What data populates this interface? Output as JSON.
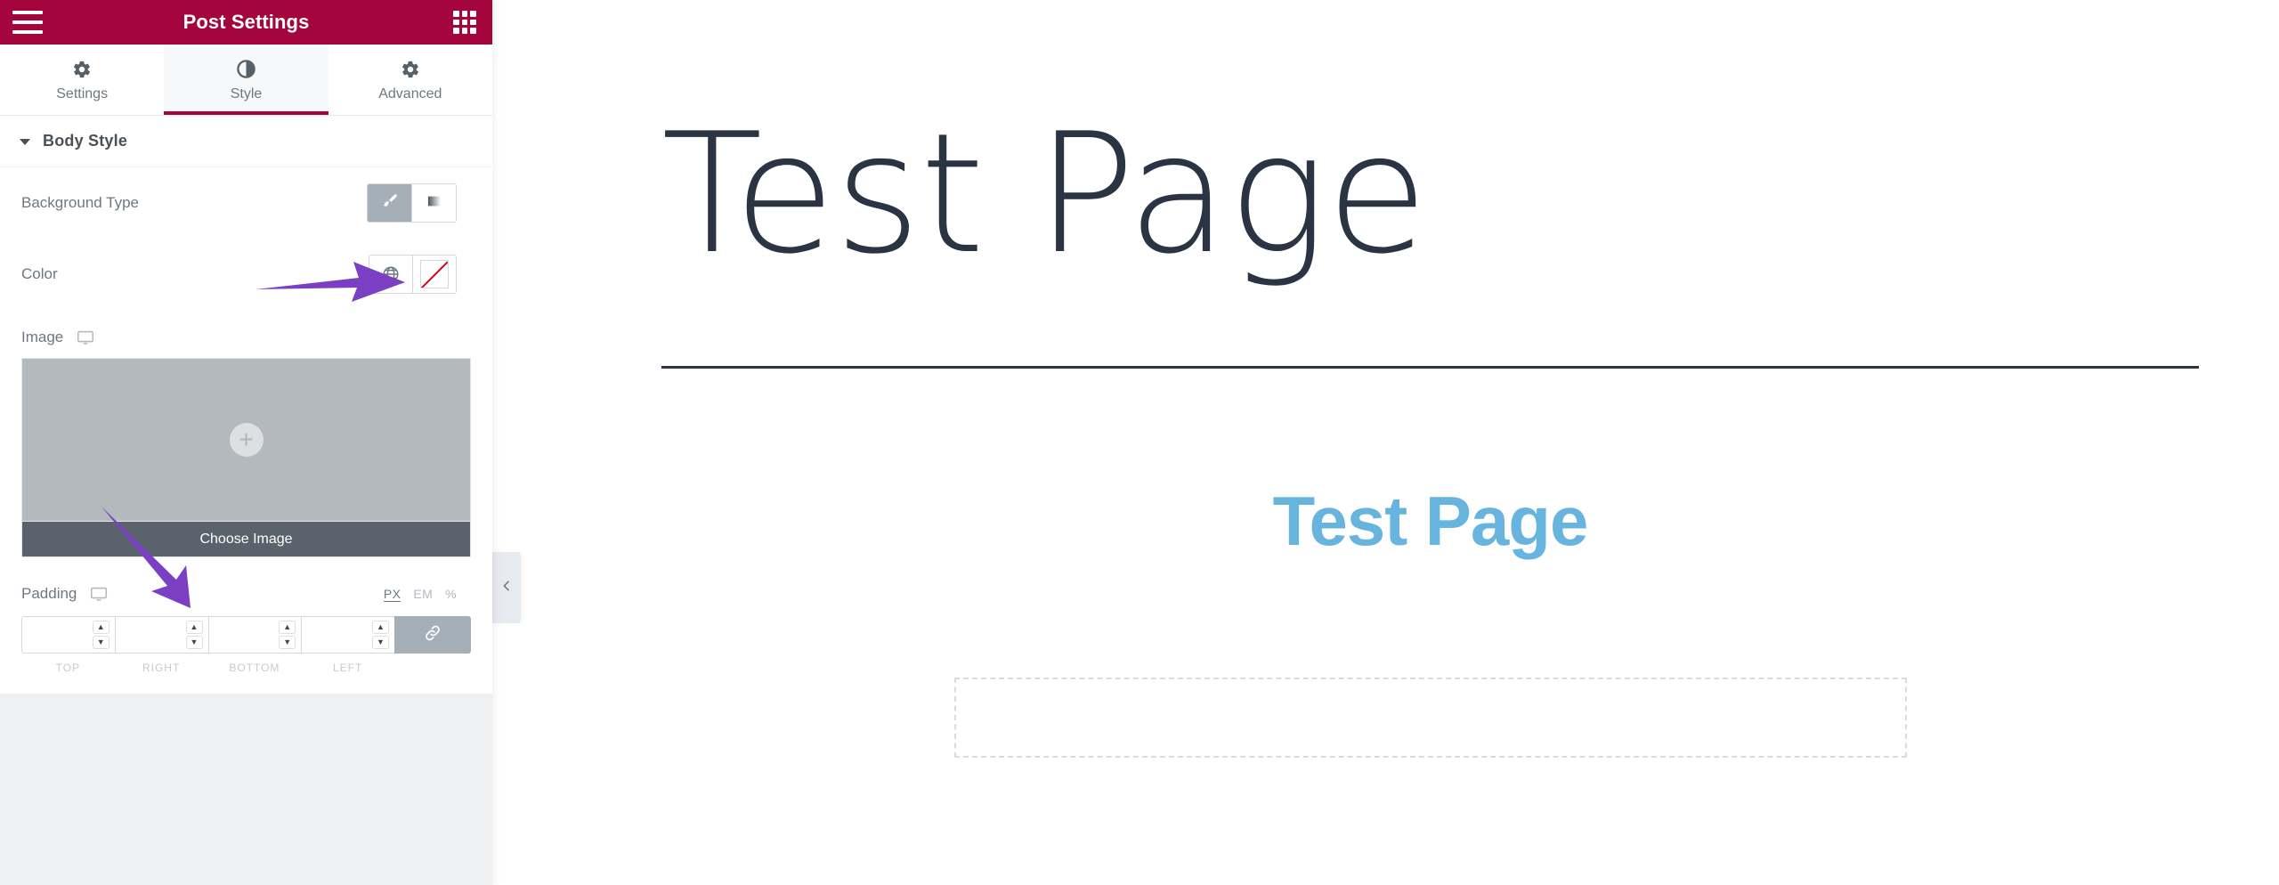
{
  "panel": {
    "header": {
      "title": "Post Settings",
      "menu_icon": "hamburger-icon",
      "apps_icon": "grid-apps-icon"
    },
    "tabs": [
      {
        "label": "Settings",
        "icon": "gear-icon",
        "active": false
      },
      {
        "label": "Style",
        "icon": "contrast-half-circle-icon",
        "active": true
      },
      {
        "label": "Advanced",
        "icon": "gear-icon",
        "active": false
      }
    ],
    "section": {
      "title": "Body Style",
      "expanded": true
    },
    "controls": {
      "background_type": {
        "label": "Background Type",
        "options": [
          {
            "name": "classic",
            "icon": "paint-brush-icon",
            "selected": true
          },
          {
            "name": "gradient",
            "icon": "gradient-square-icon",
            "selected": false
          }
        ]
      },
      "color": {
        "label": "Color",
        "globe_icon": "globe-icon",
        "swatch_icon": "no-color-swatch-icon",
        "value": ""
      },
      "image": {
        "label": "Image",
        "responsive_icon": "desktop-monitor-icon",
        "placeholder_icon": "plus-circle-icon",
        "choose_label": "Choose Image"
      },
      "padding": {
        "label": "Padding",
        "responsive_icon": "desktop-monitor-icon",
        "units": [
          {
            "label": "PX",
            "active": true
          },
          {
            "label": "EM",
            "active": false
          },
          {
            "label": "%",
            "active": false
          }
        ],
        "fields": [
          {
            "label": "TOP",
            "value": ""
          },
          {
            "label": "RIGHT",
            "value": ""
          },
          {
            "label": "BOTTOM",
            "value": ""
          },
          {
            "label": "LEFT",
            "value": ""
          }
        ],
        "link_icon": "link-chain-icon",
        "link_active": true
      }
    }
  },
  "preview": {
    "collapse_icon": "chevron-left-icon",
    "hero_title": "Test Page",
    "sub_title": "Test Page"
  },
  "annotations": [
    {
      "name": "arrow-to-background-type",
      "color": "#7b3fc4",
      "direction": "right"
    },
    {
      "name": "arrow-to-choose-image",
      "color": "#7b3fc4",
      "direction": "down-right"
    }
  ],
  "colors": {
    "brand_maroon": "#a4053c",
    "panel_bg": "#ffffff",
    "tab_active_bg": "#f7f8f9",
    "text_muted": "#6d7882",
    "image_drop": "#b4b9be",
    "choose_bar": "#5a636b",
    "hero_text": "#2b3443",
    "sub_text": "#67b4df",
    "annotation_purple": "#7b3fc4"
  }
}
